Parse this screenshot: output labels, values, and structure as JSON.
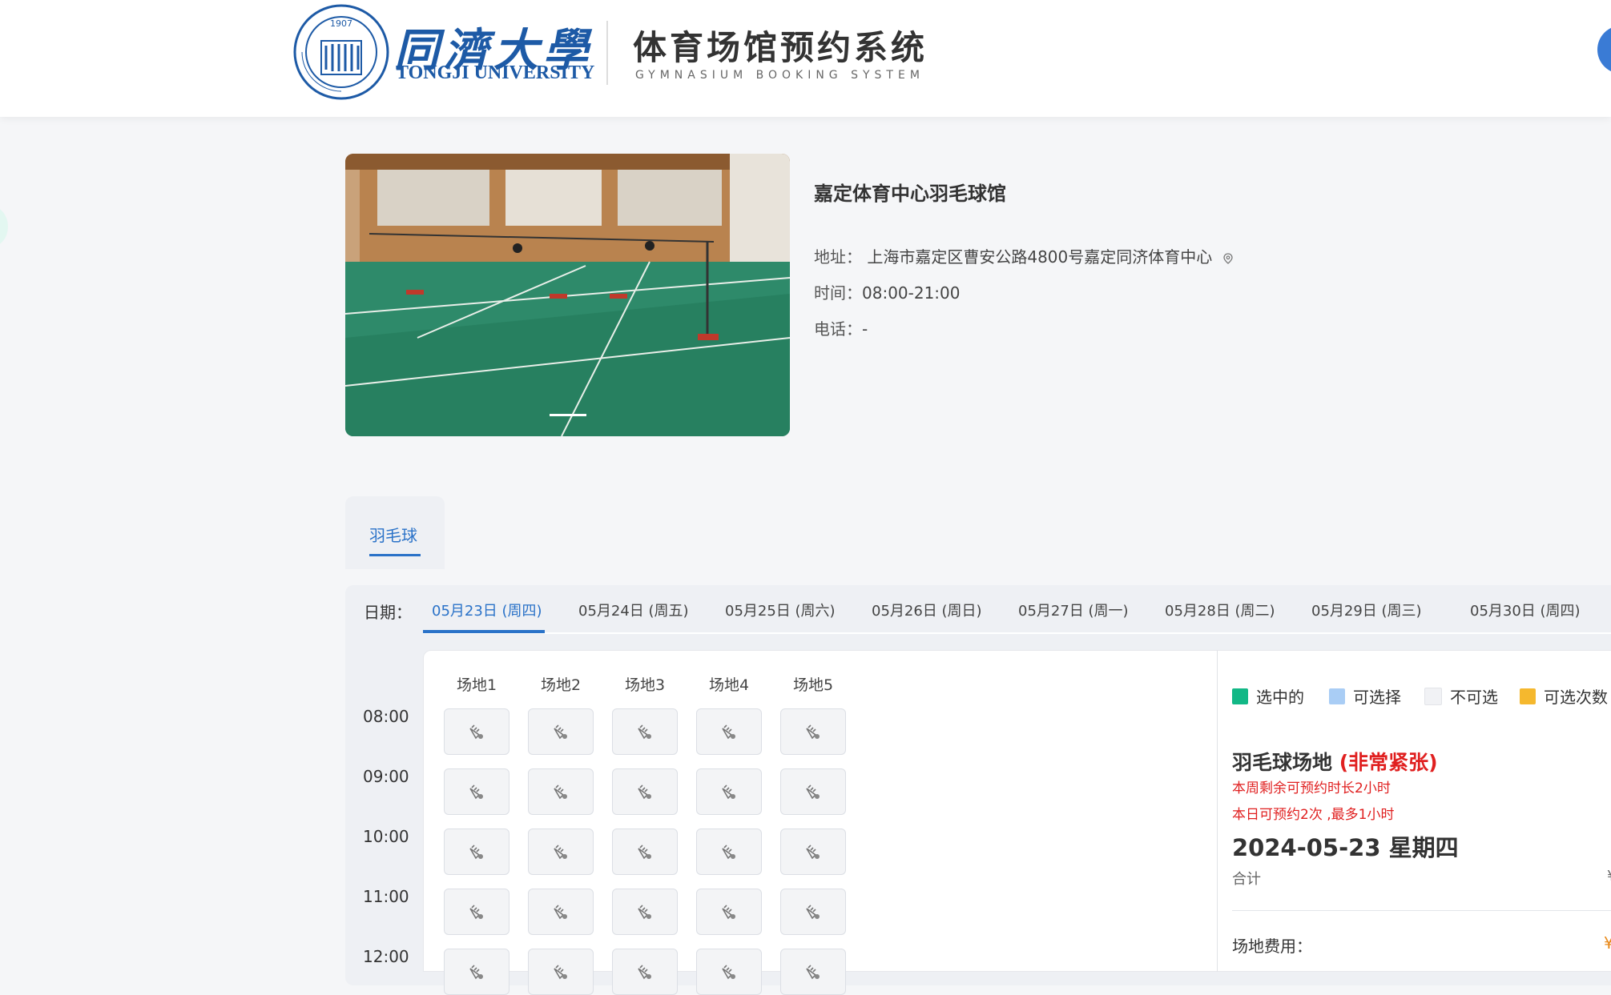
{
  "header": {
    "university_cn": "同濟大學",
    "university_en": "TONGJI UNIVERSITY",
    "seal_year": "1907",
    "system_title": "体育场馆预约系统",
    "system_subtitle": "GYMNASIUM BOOKING SYSTEM"
  },
  "venue": {
    "name": "嘉定体育中心羽毛球馆",
    "address_label": "地址：",
    "address": "上海市嘉定区曹安公路4800号嘉定同济体育中心",
    "hours_label": "时间：",
    "hours": "08:00-21:00",
    "phone_label": "电话：",
    "phone": "-"
  },
  "sport_tabs": [
    {
      "label": "羽毛球",
      "active": true
    }
  ],
  "date_bar": {
    "label": "日期：",
    "dates": [
      {
        "label": "05月23日 (周四)",
        "active": true
      },
      {
        "label": "05月24日 (周五)",
        "active": false
      },
      {
        "label": "05月25日 (周六)",
        "active": false
      },
      {
        "label": "05月26日 (周日)",
        "active": false
      },
      {
        "label": "05月27日 (周一)",
        "active": false
      },
      {
        "label": "05月28日 (周二)",
        "active": false
      },
      {
        "label": "05月29日 (周三)",
        "active": false
      },
      {
        "label": "05月30日 (周四)",
        "active": false
      }
    ]
  },
  "grid": {
    "courts": [
      "场地1",
      "场地2",
      "场地3",
      "场地4",
      "场地5"
    ],
    "times": [
      "08:00",
      "09:00",
      "10:00",
      "11:00",
      "12:00"
    ],
    "slot_state": "unavailable",
    "slot_icon": "shuttlecock-icon"
  },
  "legend": [
    {
      "label": "选中的",
      "color": "#12b886"
    },
    {
      "label": "可选择",
      "color": "#a9cdf5"
    },
    {
      "label": "不可选",
      "color": "#f1f2f5"
    },
    {
      "label": "可选次数",
      "color": "#f5b82e"
    }
  ],
  "summary": {
    "court_type": "羽毛球场地",
    "busy_tag": "(非常紧张)",
    "rule_week": "本周剩余可预约时长2小时",
    "rule_day": "本日可预约2次 ,最多1小时",
    "selected_date": "2024-05-23 星期四",
    "total_label": "合计",
    "total_edge": "¥",
    "fee_label": "场地费用：",
    "fee_edge": "¥"
  },
  "colors": {
    "brand_blue": "#1d5aa6",
    "accent_blue": "#2a72c8",
    "warning_red": "#e02020"
  }
}
